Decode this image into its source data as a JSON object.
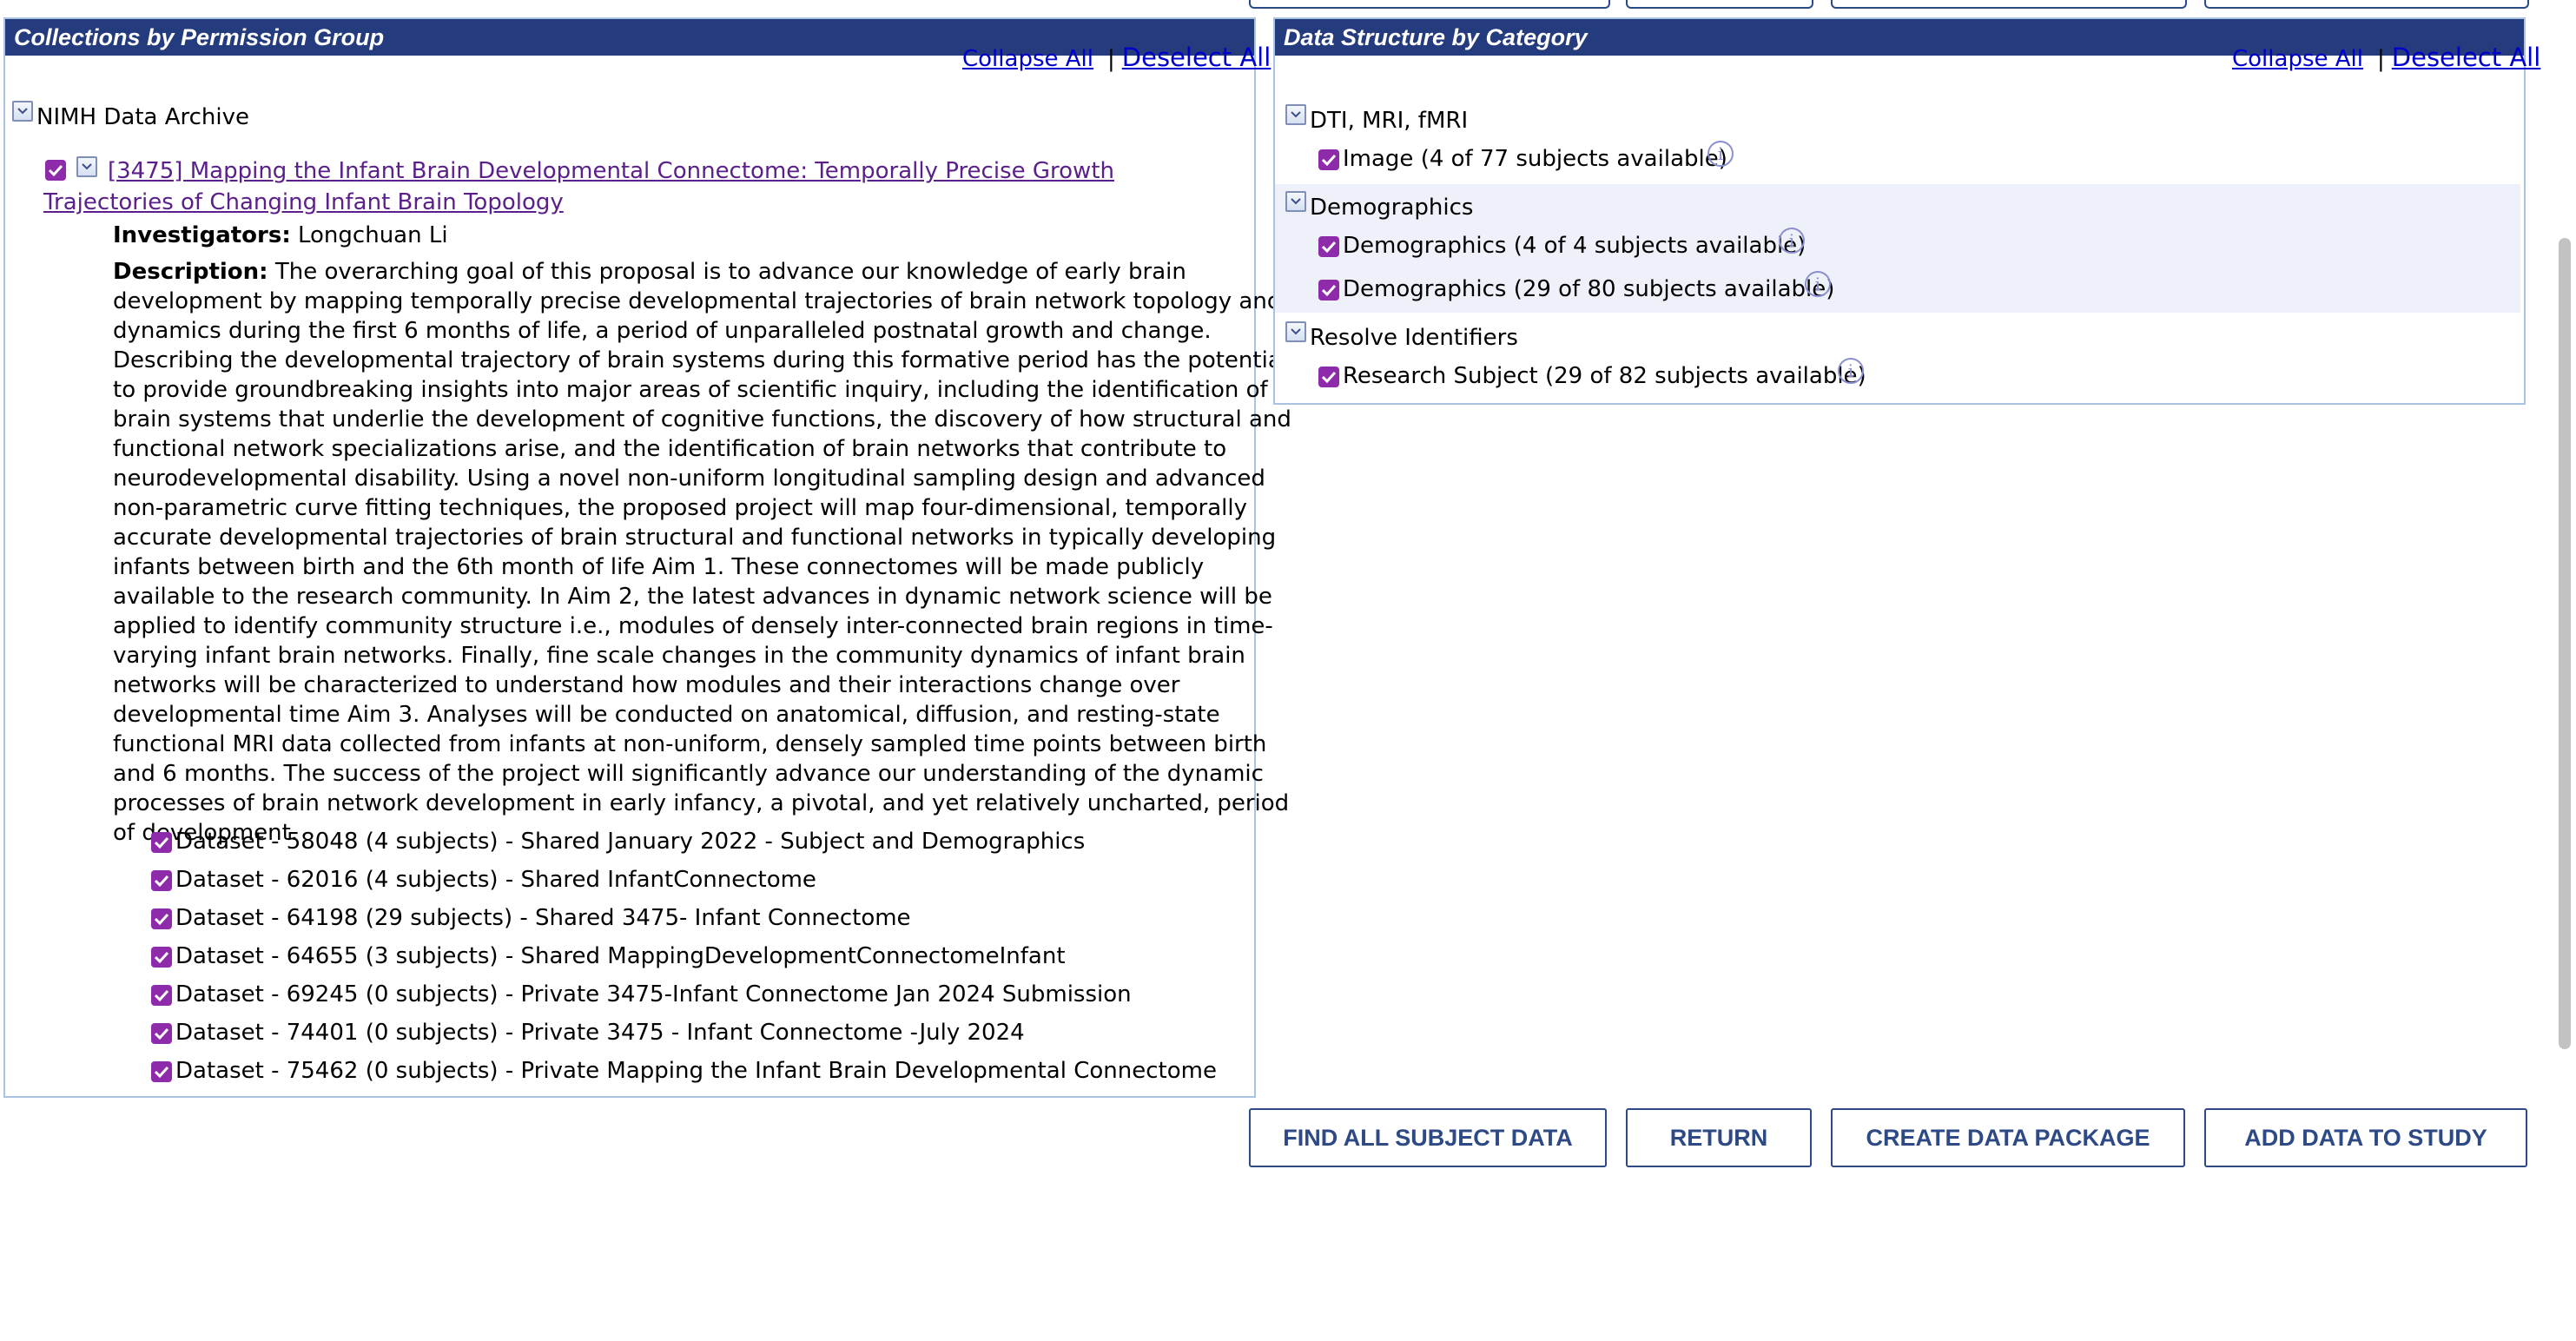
{
  "left_panel": {
    "title": "Collections by Permission Group",
    "collapse_all": "Collapse All",
    "separator": "|",
    "deselect_all": "Deselect All",
    "root_label": "NIMH Data Archive",
    "collection": {
      "link_text": "[3475] Mapping the Infant Brain Developmental Connectome: Temporally Precise Growth Trajectories of Changing Infant Brain Topology",
      "investigators_label": "Investigators:",
      "investigators_value": "Longchuan Li",
      "description_label": "Description:",
      "description_text": "The overarching goal of this proposal is to advance our knowledge of early brain development by mapping temporally precise developmental trajectories of brain network topology and dynamics during the first 6 months of life, a period of unparalleled postnatal growth and change. Describing the developmental trajectory of brain systems during this formative period has the potential to provide groundbreaking insights into major areas of scientific inquiry, including the identification of brain systems that underlie the development of cognitive functions, the discovery of how structural and functional network specializations arise, and the identification of brain networks that contribute to neurodevelopmental disability. Using a novel non-uniform longitudinal sampling design and advanced non-parametric curve fitting techniques, the proposed project will map four-dimensional, temporally accurate developmental trajectories of brain structural and functional networks in typically developing infants between birth and the 6th month of life Aim 1. These connectomes will be made publicly available to the research community. In Aim 2, the latest advances in dynamic network science will be applied to identify community structure i.e., modules of densely inter-connected brain regions in time-varying infant brain networks. Finally, fine scale changes in the community dynamics of infant brain networks will be characterized to understand how modules and their interactions change over developmental time Aim 3. Analyses will be conducted on anatomical, diffusion, and resting-state functional MRI data collected from infants at non-uniform, densely sampled time points between birth and 6 months. The success of the project will significantly advance our understanding of the dynamic processes of brain network development in early infancy, a pivotal, and yet relatively uncharted, period of development."
    },
    "datasets": [
      "Dataset - 58048 (4 subjects) - Shared January 2022 - Subject and Demographics",
      "Dataset - 62016 (4 subjects) - Shared InfantConnectome",
      "Dataset - 64198 (29 subjects) - Shared 3475- Infant Connectome",
      "Dataset - 64655 (3 subjects) - Shared MappingDevelopmentConnectomeInfant",
      "Dataset - 69245 (0 subjects) - Private 3475-Infant Connectome Jan 2024 Submission",
      "Dataset - 74401 (0 subjects) - Private 3475 - Infant Connectome -July 2024",
      "Dataset - 75462 (0 subjects) - Private Mapping the Infant Brain Developmental Connectome"
    ]
  },
  "right_panel": {
    "title": "Data Structure by Category",
    "collapse_all": "Collapse All",
    "separator": "|",
    "deselect_all": "Deselect All",
    "categories": [
      {
        "name": "DTI, MRI, fMRI",
        "items": [
          "Image (4 of 77 subjects available)"
        ]
      },
      {
        "name": "Demographics",
        "items": [
          "Demographics (4 of 4 subjects available)",
          "Demographics (29 of 80 subjects available)"
        ]
      },
      {
        "name": "Resolve Identifiers",
        "items": [
          "Research Subject (29 of 82 subjects available)"
        ]
      }
    ],
    "info_glyph": "i"
  },
  "buttons": {
    "find_all": "FIND ALL SUBJECT DATA",
    "return": "RETURN",
    "create_package": "CREATE DATA PACKAGE",
    "add_to_study": "ADD DATA TO STUDY"
  },
  "icons": {
    "checkbox": "checkmark-icon",
    "collapse": "chevron-down-icon",
    "info": "info-icon"
  },
  "colors": {
    "header_bg": "#243b7d",
    "checkbox": "#8e2bab",
    "link": "#0000cc",
    "visited_link": "#5a1f8a",
    "button_border": "#2e4a86",
    "panel_border": "#a9c4e0"
  }
}
